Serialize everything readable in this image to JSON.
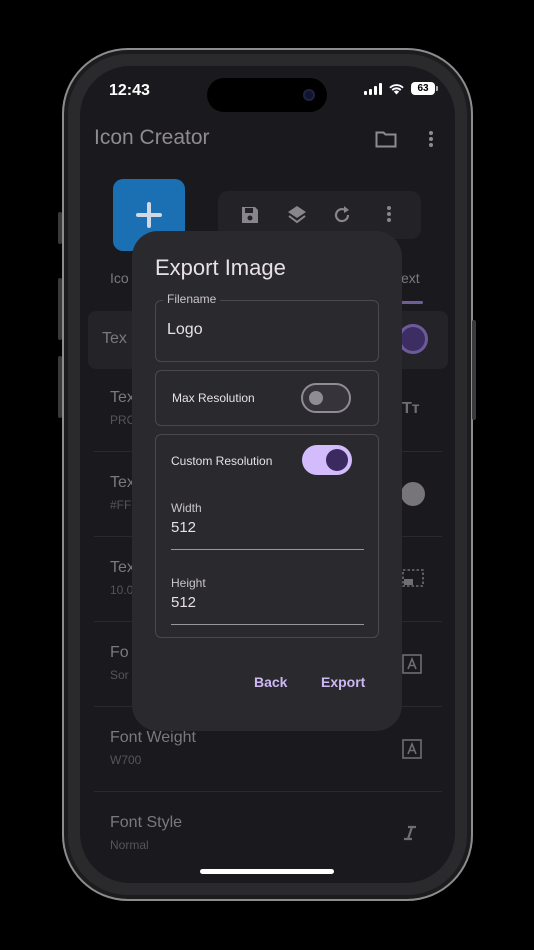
{
  "status_bar": {
    "time": "12:43",
    "battery": "63"
  },
  "app": {
    "title": "Icon Creator",
    "tab_left_partial": "Ico",
    "tab_right_partial": "ext"
  },
  "rows": [
    {
      "title": "Tex",
      "subtitle": ""
    },
    {
      "title": "Tex",
      "subtitle": "PRO"
    },
    {
      "title": "Tex",
      "subtitle": "#FF"
    },
    {
      "title": "Tex",
      "subtitle": "10.0"
    },
    {
      "title": "Fo",
      "subtitle": "Sor"
    },
    {
      "title": "Font Weight",
      "subtitle": "W700"
    },
    {
      "title": "Font Style",
      "subtitle": "Normal"
    }
  ],
  "dialog": {
    "title": "Export Image",
    "filename_label": "Filename",
    "filename_value": "Logo",
    "max_resolution_label": "Max Resolution",
    "max_resolution_on": false,
    "custom_resolution_label": "Custom Resolution",
    "custom_resolution_on": true,
    "width_label": "Width",
    "width_value": "512",
    "height_label": "Height",
    "height_value": "512",
    "back_label": "Back",
    "export_label": "Export"
  },
  "colors": {
    "accent": "#d2bcfb",
    "dialog_bg": "#2a292d",
    "fab": "#1b6fb3"
  }
}
